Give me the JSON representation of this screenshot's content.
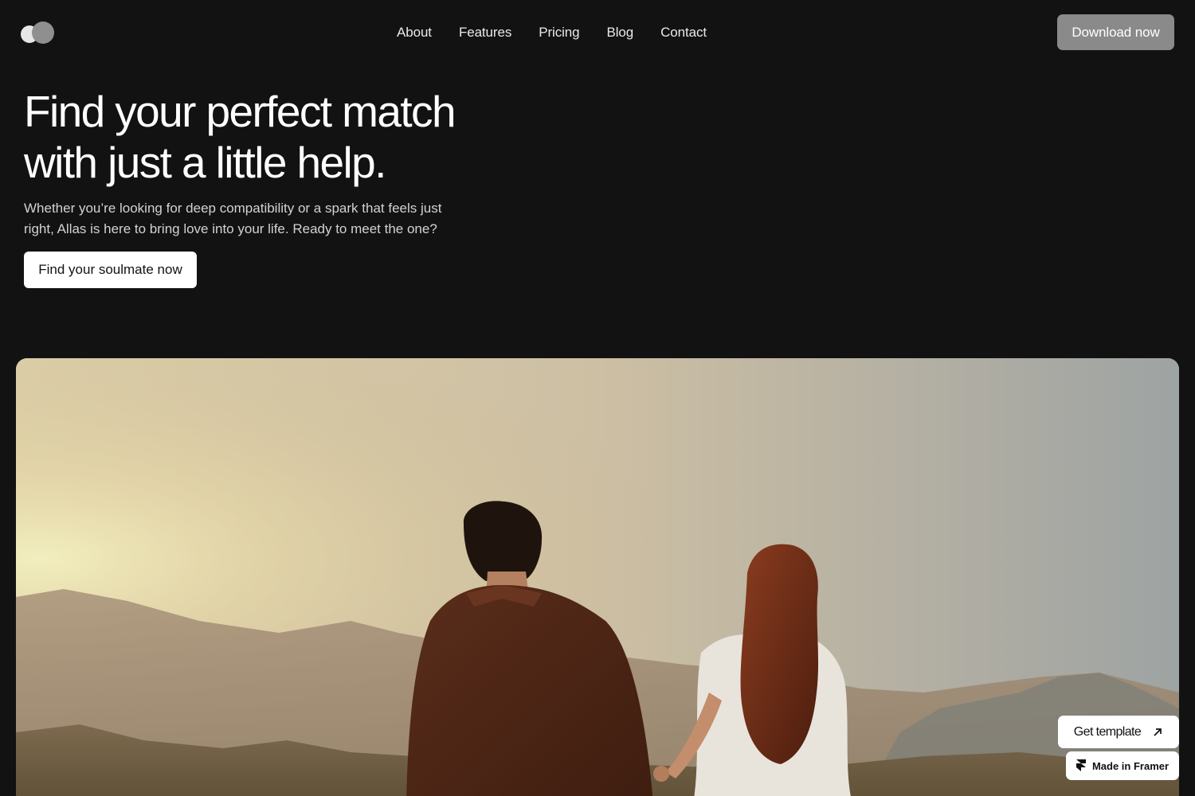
{
  "nav": {
    "items": [
      "About",
      "Features",
      "Pricing",
      "Blog",
      "Contact"
    ],
    "download_label": "Download now"
  },
  "hero": {
    "title_line1": "Find your perfect match",
    "title_line2": "with just a little help.",
    "subtitle": "Whether you’re looking for deep compatibility or a spark that feels just right, Allas is here to bring love into your life. Ready to meet the one?",
    "cta_label": "Find your soulmate now"
  },
  "badges": {
    "get_template_label": "Get template",
    "made_in_framer_label": "Made in Framer"
  },
  "icons": {
    "logo": "toggle-logo-icon",
    "arrow": "arrow-up-right-icon",
    "framer": "framer-icon"
  },
  "colors": {
    "background": "#121212",
    "download_button": "#8a8a8a",
    "cta_button": "#ffffff"
  }
}
